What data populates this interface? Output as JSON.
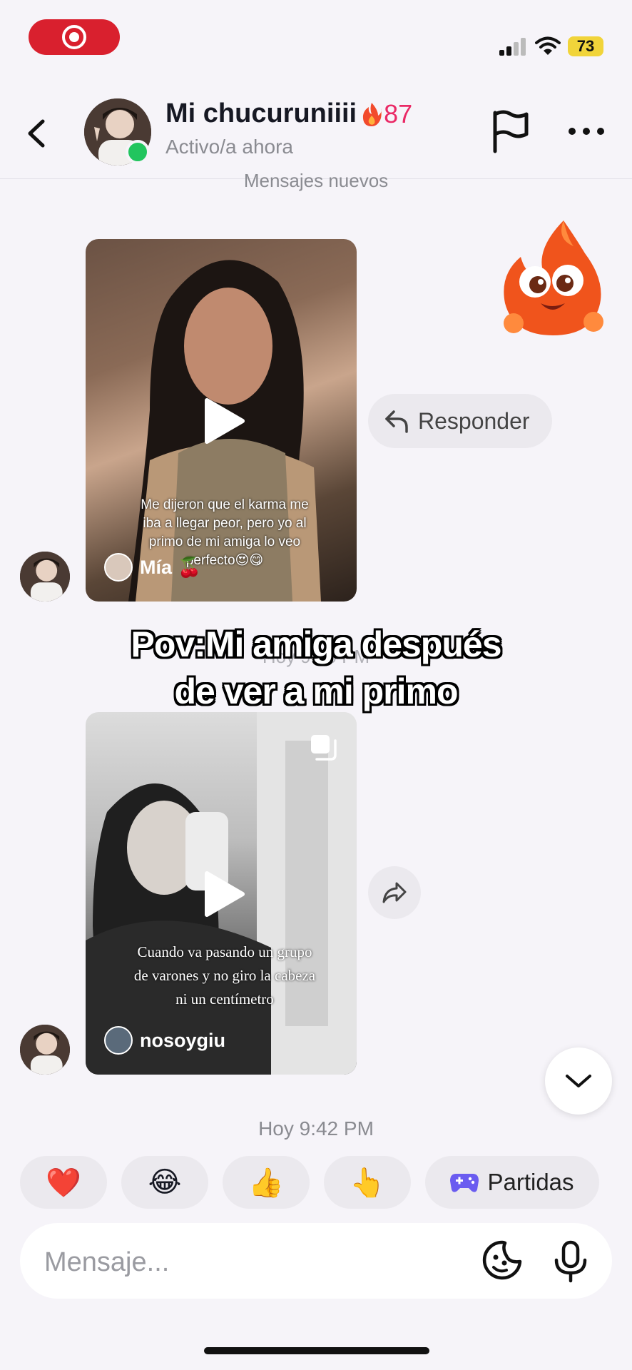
{
  "status_bar": {
    "battery": "73"
  },
  "header": {
    "contact_name": "Mi chucuruniiii",
    "streak_count": "87",
    "presence": "Activo/a ahora"
  },
  "chat": {
    "new_messages_divider": "Mensajes nuevos",
    "message1": {
      "caption": "Me dijeron que el karma me iba a llegar peor, pero yo al primo de mi amiga lo veo perfecto😍😋",
      "author": "Mía 🍒"
    },
    "reply_label": "Responder",
    "overlay_text_line1": "Pov:Mi amiga después",
    "overlay_text_line2": "de ver a mi primo",
    "ghost_timestamp": "Hoy 9:40 PM",
    "message2": {
      "caption": "Cuando va pasando un grupo de varones y no giro la cabeza ni un centímetro",
      "author": "nosoygiu"
    },
    "timestamp": "Hoy 9:42 PM"
  },
  "quick_reactions": {
    "items": [
      "❤️",
      "😂",
      "👍",
      "👆"
    ],
    "games_label": "Partidas"
  },
  "composer": {
    "placeholder": "Mensaje..."
  },
  "colors": {
    "streak": "#ea2966",
    "online": "#22c55e",
    "record": "#d9202e",
    "battery": "#f1d43a"
  }
}
